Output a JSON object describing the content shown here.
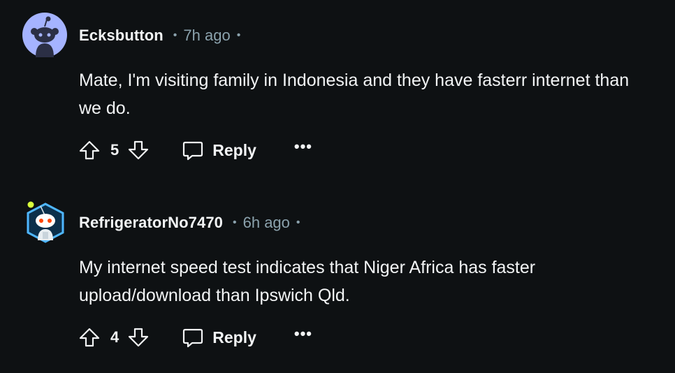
{
  "comments": [
    {
      "author": "Ecksbutton",
      "time": "7h ago",
      "separator": "•",
      "body": "Mate, I'm visiting family in Indonesia and they have fasterr internet than we do.",
      "score": "5",
      "reply_label": "Reply",
      "more_label": "•••",
      "avatar": "snoo-default-avatar"
    },
    {
      "author": "RefrigeratorNo7470",
      "time": "6h ago",
      "separator": "•",
      "body": "My internet speed test indicates that Niger Africa has faster upload/download than Ipswich Qld.",
      "score": "4",
      "reply_label": "Reply",
      "more_label": "•••",
      "avatar": "snoo-custom-avatar"
    }
  ],
  "colors": {
    "background": "#0e1113",
    "text": "#f2f4f5",
    "meta": "#8ba2ad",
    "avatar_bg": "#a5b3ff"
  }
}
